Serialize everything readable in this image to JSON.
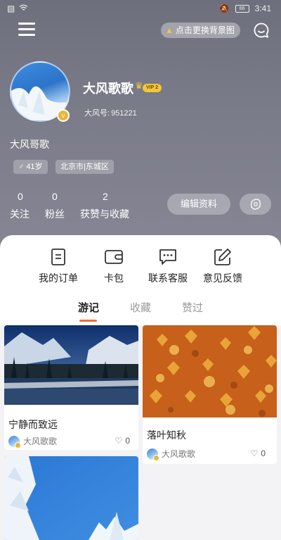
{
  "status_bar": {
    "time": "3:41",
    "battery": "86"
  },
  "header": {
    "change_bg_label": "点击更换背景图"
  },
  "profile": {
    "username": "大风歌歌",
    "vip_label": "VIP 2",
    "id_label": "大风号:",
    "id_value": "951221",
    "nickname": "大风哥歌",
    "age_tag": "41岁",
    "location_tag": "北京市|东城区",
    "stats": [
      {
        "count": "0",
        "label": "关注"
      },
      {
        "count": "0",
        "label": "粉丝"
      },
      {
        "count": "2",
        "label": "获赞与收藏"
      }
    ],
    "edit_label": "编辑资料"
  },
  "actions": [
    {
      "label": "我的订单",
      "icon": "order-icon"
    },
    {
      "label": "卡包",
      "icon": "wallet-icon"
    },
    {
      "label": "联系客服",
      "icon": "chat-bubble-icon"
    },
    {
      "label": "意见反馈",
      "icon": "feedback-edit-icon"
    }
  ],
  "tabs": [
    {
      "label": "游记",
      "active": true
    },
    {
      "label": "收藏",
      "active": false
    },
    {
      "label": "赞过",
      "active": false
    }
  ],
  "posts": [
    {
      "title": "宁静而致远",
      "author": "大风歌歌",
      "likes": "0"
    },
    {
      "title": "落叶知秋",
      "author": "大风歌歌",
      "likes": "0"
    },
    {
      "title": "",
      "author": "",
      "likes": ""
    }
  ],
  "colors": {
    "accent": "#f36b3b",
    "header_bg": "#767785",
    "vip": "#f3c63b"
  }
}
